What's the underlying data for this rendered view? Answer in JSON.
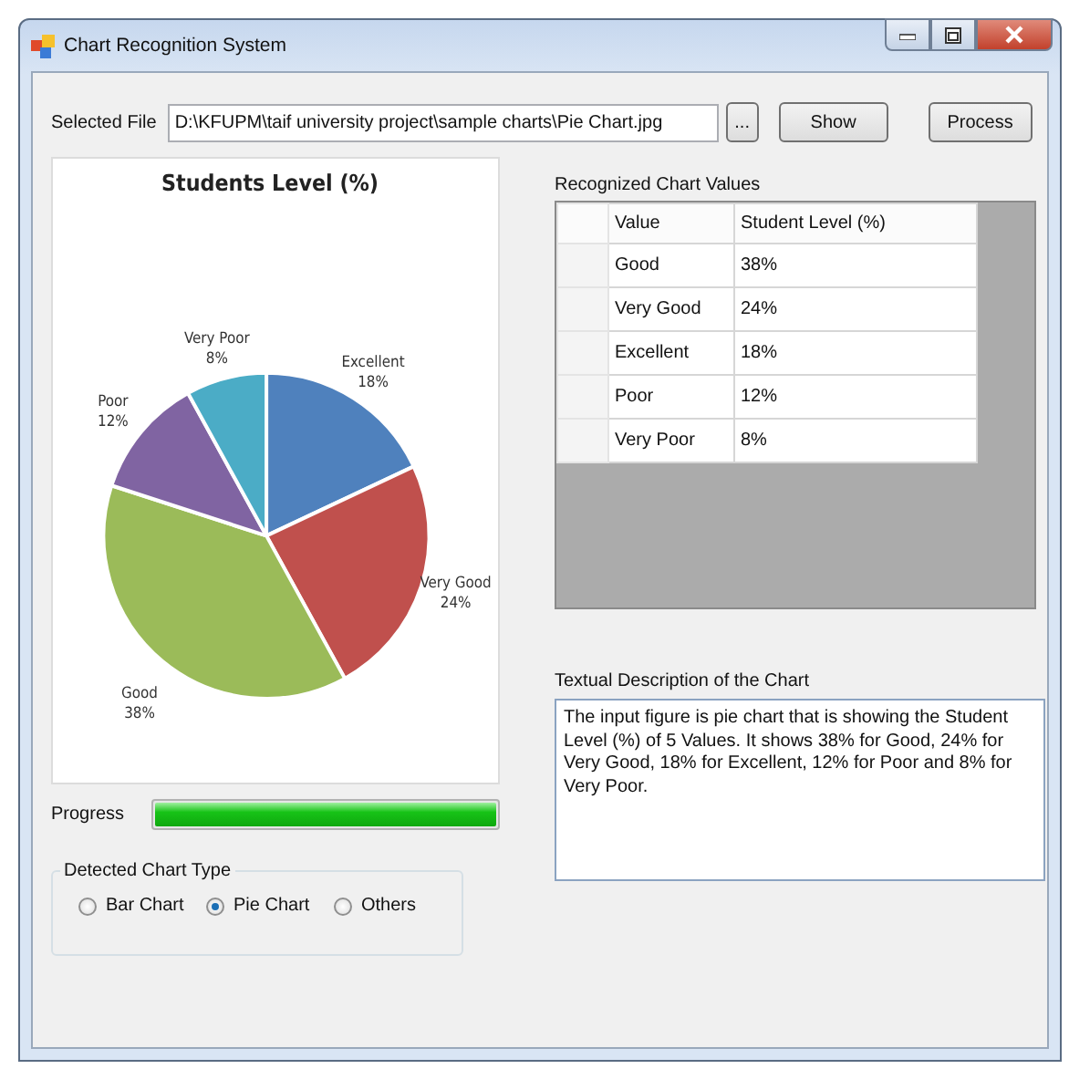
{
  "window": {
    "title": "Chart Recognition System"
  },
  "file": {
    "label": "Selected File",
    "value": "D:\\KFUPM\\taif university project\\sample charts\\Pie Chart.jpg"
  },
  "buttons": [
    {
      "label": "...",
      "kind": "browse"
    },
    {
      "label": "Show",
      "kind": "show"
    },
    {
      "label": "Process",
      "kind": "process"
    }
  ],
  "preview": {
    "chart_data": {
      "type": "pie",
      "title": "Students Level (%)",
      "categories": [
        "Excellent",
        "Very Good",
        "Good",
        "Poor",
        "Very Poor"
      ],
      "values": [
        18,
        24,
        38,
        12,
        8
      ],
      "value_labels": [
        "18%",
        "24%",
        "38%",
        "12%",
        "8%"
      ]
    }
  },
  "values_grid": {
    "title": "Recognized Chart Values",
    "columns": [
      "Value",
      "Student Level (%)"
    ],
    "rows": [
      [
        "Good",
        "38%"
      ],
      [
        "Very Good",
        "24%"
      ],
      [
        "Excellent",
        "18%"
      ],
      [
        "Poor",
        "12%"
      ],
      [
        "Very Poor",
        "8%"
      ]
    ]
  },
  "description": {
    "title": "Textual Description of the Chart",
    "value": "The input figure is pie chart that is showing the Student Level (%) of 5 Values. It shows 38% for Good, 24% for Very Good, 18% for Excellent, 12% for Poor and 8% for Very Poor."
  },
  "progress": {
    "label": "Progress",
    "level": 1
  },
  "chart_type": {
    "title": "Detected Chart Type",
    "options": [
      {
        "label": "Bar Chart",
        "selected": false
      },
      {
        "label": "Pie Chart",
        "selected": true
      },
      {
        "label": "Others",
        "selected": false
      }
    ]
  }
}
